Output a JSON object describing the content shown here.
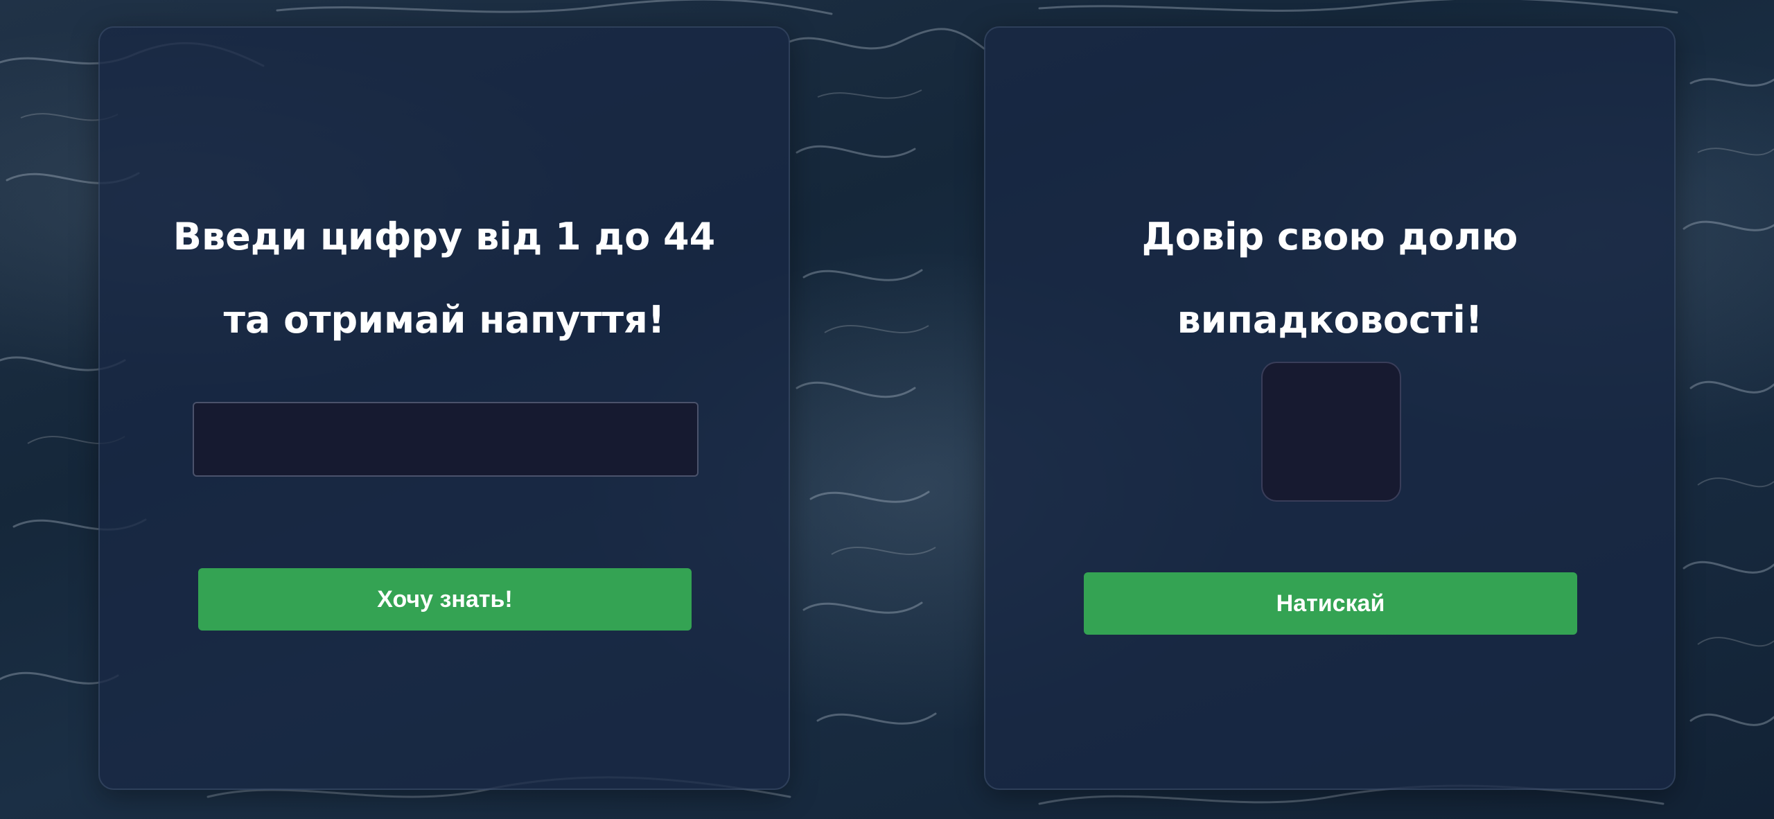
{
  "colors": {
    "card_background": "#182844",
    "input_background": "#161a30",
    "button": "#34a353",
    "text": "#ffffff"
  },
  "left_card": {
    "title_line1": "Введи цифру від 1 до 44",
    "title_line2": "та отримай напуття!",
    "input_value": "",
    "input_placeholder": "",
    "button_label": "Хочу знать!"
  },
  "right_card": {
    "title_line1": "Довір свою долю",
    "title_line2": "випадковості!",
    "result_value": "",
    "button_label": "Натискай"
  }
}
